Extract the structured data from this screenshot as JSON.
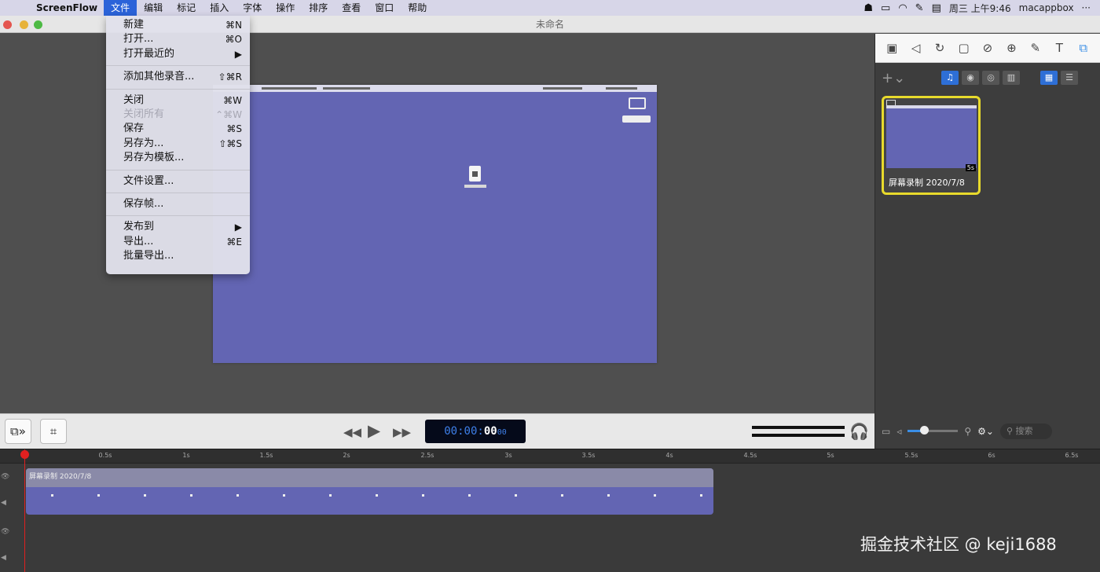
{
  "menubar": {
    "app_name": "ScreenFlow",
    "items": [
      "文件",
      "编辑",
      "标记",
      "插入",
      "字体",
      "操作",
      "排序",
      "查看",
      "窗口",
      "帮助"
    ],
    "clock": "周三 上午9:46",
    "user": "macappbox",
    "more": "···"
  },
  "window": {
    "title": "未命名"
  },
  "file_menu": {
    "new": {
      "label": "新建",
      "shortcut": "⌘N"
    },
    "open": {
      "label": "打开...",
      "shortcut": "⌘O"
    },
    "open_recent": {
      "label": "打开最近的",
      "arrow": "▶"
    },
    "add_audio": {
      "label": "添加其他录音...",
      "shortcut": "⇧⌘R"
    },
    "close": {
      "label": "关闭",
      "shortcut": "⌘W"
    },
    "close_all": {
      "label": "关闭所有",
      "shortcut": "⌃⌘W"
    },
    "save": {
      "label": "保存",
      "shortcut": "⌘S"
    },
    "save_as": {
      "label": "另存为...",
      "shortcut": "⇧⌘S"
    },
    "save_template": {
      "label": "另存为模板..."
    },
    "doc_settings": {
      "label": "文件设置..."
    },
    "save_frame": {
      "label": "保存帧..."
    },
    "publish": {
      "label": "发布到",
      "arrow": "▶"
    },
    "export": {
      "label": "导出...",
      "shortcut": "⌘E"
    },
    "batch_export": {
      "label": "批量导出..."
    }
  },
  "media_library": {
    "clip_caption": "屏幕录制 2020/7/8",
    "clip_duration": "5s"
  },
  "playback": {
    "timecode_dim": "00:00:",
    "timecode_bright": "00",
    "timecode_frames": "00"
  },
  "inspector_bar": {
    "search_placeholder": "搜索"
  },
  "timeline": {
    "ruler": [
      "0.5s",
      "1s",
      "1.5s",
      "2s",
      "2.5s",
      "3s",
      "3.5s",
      "4s",
      "4.5s",
      "5s",
      "5.5s",
      "6s",
      "6.5s"
    ],
    "clip_title": "屏幕录制 2020/7/8"
  },
  "watermark": "掘金技术社区 @ keji1688",
  "colors": {
    "accent": "#2b63d9",
    "clip": "#6365b3",
    "selection": "#e8da2c",
    "playhead": "#e02020"
  }
}
